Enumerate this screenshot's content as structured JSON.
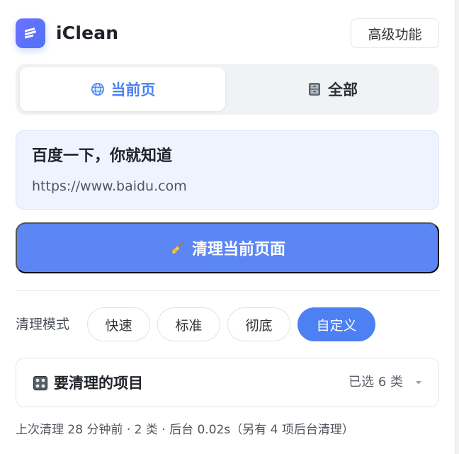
{
  "app": {
    "title": "iClean",
    "logo_icon": "broom-lines-icon",
    "advanced_label": "高级功能"
  },
  "tabs": [
    {
      "label": "当前页",
      "icon": "globe-icon",
      "active": true
    },
    {
      "label": "全部",
      "icon": "cabinet-icon",
      "active": false
    }
  ],
  "page": {
    "title": "百度一下，你就知道",
    "url": "https://www.baidu.com"
  },
  "actions": {
    "clean_current_label": "清理当前页面",
    "clean_icon": "broom-icon"
  },
  "mode": {
    "label": "清理模式",
    "options": [
      {
        "label": "快速",
        "active": false
      },
      {
        "label": "标准",
        "active": false
      },
      {
        "label": "彻底",
        "active": false
      },
      {
        "label": "自定义",
        "active": true
      }
    ]
  },
  "items": {
    "title": "要清理的项目",
    "icon": "control-knobs-icon",
    "selected_label": "已选 6 类",
    "caret_icon": "caret-down-icon"
  },
  "status": {
    "text": "上次清理 28 分钟前 · 2 类 · 后台 0.02s（另有 4 项后台清理）"
  },
  "colors": {
    "accent": "#5b86f4",
    "active_mode": "#4d80f2",
    "tab_active_text": "#4c80f1",
    "page_info_bg": "#eef3ff"
  }
}
